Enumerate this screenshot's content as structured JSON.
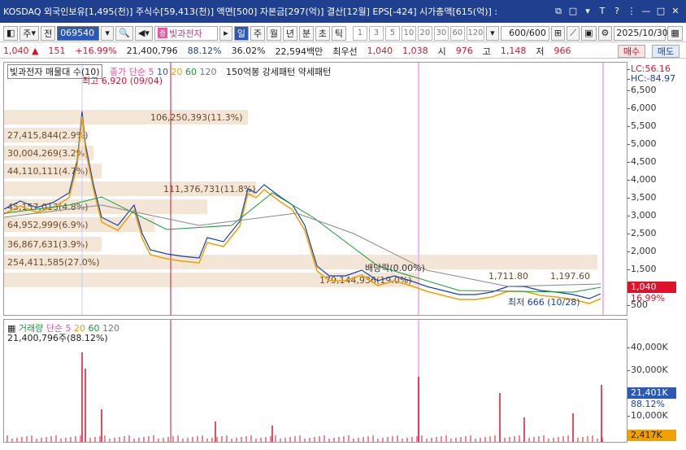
{
  "titlebar": {
    "info": "KOSDAQ 외국인보유[1,495(천)] 주식수[59,413(천)] 액면[500] 자본금[297(억)] 결산[12월] EPS[-424] 시가총액[615(억)] :",
    "controls": [
      "⧉",
      "□",
      "▾",
      "T",
      "?",
      "⋮",
      "—",
      "□",
      "✕"
    ]
  },
  "toolbar": {
    "market": "주",
    "prefix": "전",
    "code": "069540",
    "name_badge": "증",
    "name": "빛과전자",
    "periods": [
      "일",
      "주",
      "월",
      "년",
      "분",
      "초",
      "틱"
    ],
    "active_period": "일",
    "intervals": [
      "1",
      "3",
      "5",
      "10",
      "20",
      "30",
      "60",
      "120"
    ],
    "count": "600/600",
    "date": "2025/10/30"
  },
  "priceline": {
    "price": "1,040",
    "change": "151",
    "change_pct": "+16.99%",
    "volume": "21,400,796",
    "vol_ratio": "88.12%",
    "turnover": "36.02%",
    "amount": "22,594백만",
    "label_best": "최우선",
    "bid": "1,040",
    "ask": "1,038",
    "label_open": "시",
    "open": "976",
    "label_high": "고",
    "high": "1,148",
    "label_low": "저",
    "low": "966",
    "buy": "매수",
    "sell": "매도"
  },
  "price_chart": {
    "legend_box": "빛과전자 매물대 수(10)",
    "legend_ma": "종가 단순",
    "ma_periods": [
      "5",
      "10",
      "20",
      "60",
      "120"
    ],
    "legend_pattern": "150억봉 강세패턴   약세패턴",
    "lc": "LC:56.16",
    "hc": "HC:-84.97",
    "y_ticks": [
      "6,500",
      "6,000",
      "5,500",
      "5,000",
      "4,500",
      "4,000",
      "3,500",
      "3,000",
      "2,500",
      "2,000",
      "1,500",
      "1,000",
      "500"
    ],
    "current_tag": "1,040",
    "current_pct": "16.99%",
    "high_label": "최고 6,920 (09/04)",
    "low_label": "최저 666 (10/28)",
    "volume_profile": [
      "106,250,393(11.3%)",
      "27,415,844(2.9%)",
      "30,004,269(3.2%)",
      "44,110,111(4.7%)",
      "111,376,731(11.8%)",
      "45,157,013(4.8%)",
      "64,952,999(6.9%)",
      "36,867,631(3.9%)",
      "254,411,585(27.0%)",
      "179,144,936(19.0%)"
    ],
    "annot_mid": "1,711.80",
    "annot_right": "1,197.60",
    "annot_dang": "배당락(0.00%)"
  },
  "volume_chart": {
    "legend_title": "거래량",
    "legend_ma": "단순",
    "ma_periods": [
      "5",
      "20",
      "60",
      "120"
    ],
    "volume_label": "21,400,796주(88.12%)",
    "y_ticks": [
      "40,000K",
      "30,000K",
      "20,000K",
      "10,000K"
    ],
    "current_tag": "21,401K",
    "current_pct": "88.12%",
    "ma_tag": "2,417K"
  },
  "colors": {
    "title_bg": "#1f3f8f",
    "up": "#e0112b",
    "down": "#1941a8",
    "ma5": "#e6559d",
    "ma10": "#2a59b8",
    "ma20": "#f0a000",
    "ma60": "#1a9a3a",
    "ma120": "#777777"
  }
}
